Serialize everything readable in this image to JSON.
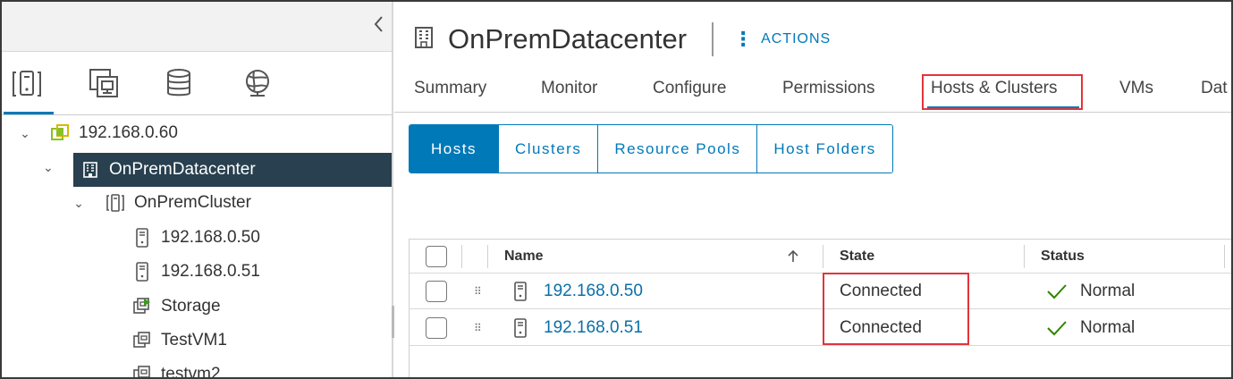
{
  "sidebar": {
    "collapse_icon": "chevron-left-icon",
    "icon_tabs": [
      {
        "icon": "hosts-clusters-icon",
        "active": true
      },
      {
        "icon": "vms-templates-icon",
        "active": false
      },
      {
        "icon": "storage-icon",
        "active": false
      },
      {
        "icon": "networking-icon",
        "active": false
      }
    ],
    "tree": [
      {
        "label": "192.168.0.60",
        "icon": "vcenter-icon",
        "expanded": true
      },
      {
        "label": "OnPremDatacenter",
        "icon": "datacenter-icon",
        "expanded": true,
        "selected": true
      },
      {
        "label": "OnPremCluster",
        "icon": "cluster-icon",
        "expanded": true
      },
      {
        "label": "192.168.0.50",
        "icon": "host-icon"
      },
      {
        "label": "192.168.0.51",
        "icon": "host-icon"
      },
      {
        "label": "Storage",
        "icon": "vm-powered-on-icon"
      },
      {
        "label": "TestVM1",
        "icon": "vm-icon"
      },
      {
        "label": "testvm2",
        "icon": "vm-icon"
      }
    ]
  },
  "header": {
    "icon": "datacenter-icon",
    "title": "OnPremDatacenter",
    "actions_label": "ACTIONS"
  },
  "tabs": [
    {
      "label": "Summary"
    },
    {
      "label": "Monitor"
    },
    {
      "label": "Configure"
    },
    {
      "label": "Permissions"
    },
    {
      "label": "Hosts & Clusters",
      "active": true
    },
    {
      "label": "VMs"
    },
    {
      "label": "Dat"
    }
  ],
  "subtabs": [
    {
      "label": "Hosts",
      "active": true
    },
    {
      "label": "Clusters"
    },
    {
      "label": "Resource Pools"
    },
    {
      "label": "Host Folders"
    }
  ],
  "table": {
    "columns": [
      "Name",
      "State",
      "Status"
    ],
    "sort_icon": "arrow-up-icon",
    "rows": [
      {
        "name": "192.168.0.50",
        "state": "Connected",
        "status": "Normal"
      },
      {
        "name": "192.168.0.51",
        "state": "Connected",
        "status": "Normal"
      }
    ]
  },
  "colors": {
    "accent": "#0079b8",
    "selected_bg": "#28404f",
    "highlight": "#e0353a",
    "ok": "#2f8400"
  }
}
